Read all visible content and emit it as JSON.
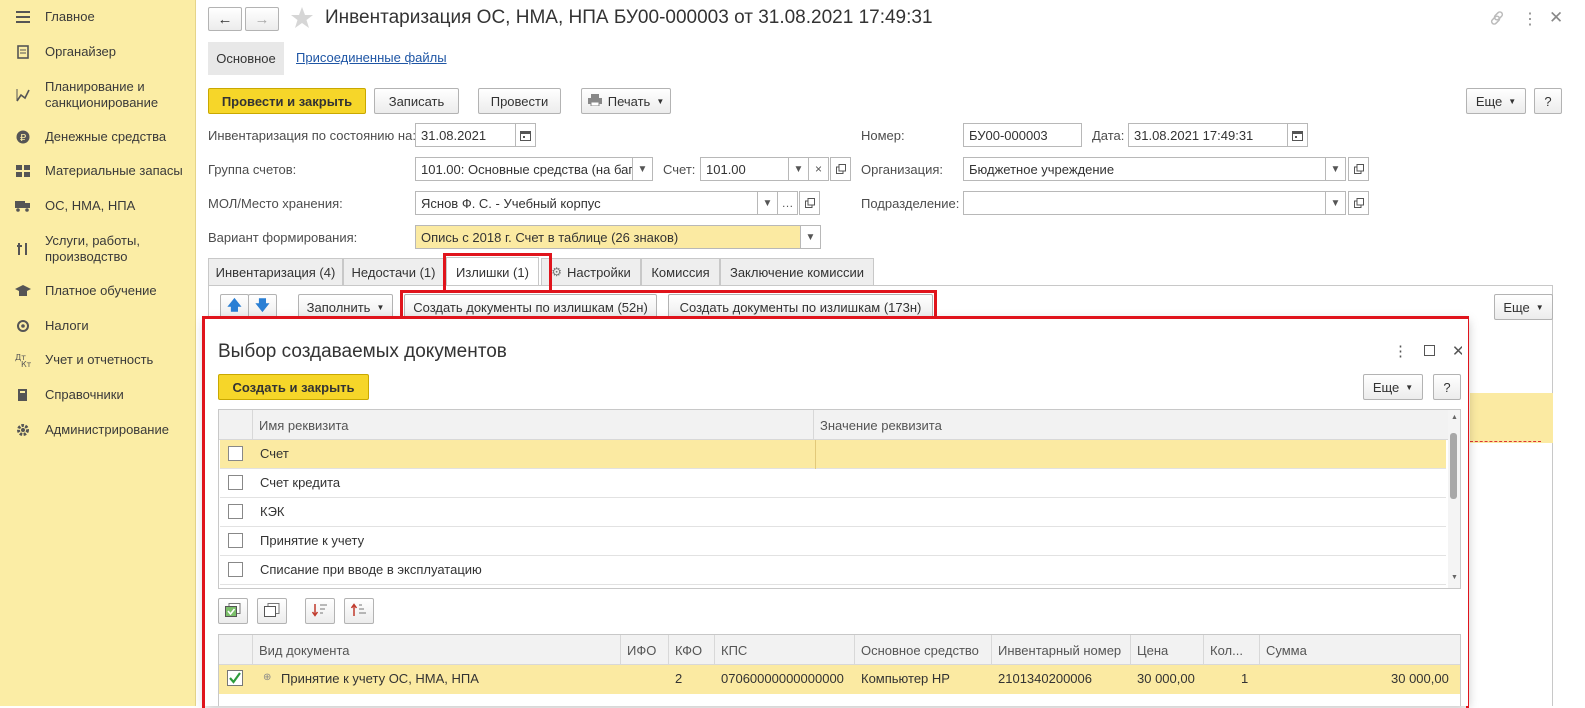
{
  "sidebar": {
    "items": [
      {
        "label": "Главное",
        "icon": "menu-icon"
      },
      {
        "label": "Органайзер",
        "icon": "organizer-icon"
      },
      {
        "label": "Планирование и санкционирование",
        "icon": "planning-icon"
      },
      {
        "label": "Денежные средства",
        "icon": "money-icon"
      },
      {
        "label": "Материальные запасы",
        "icon": "stock-icon"
      },
      {
        "label": "ОС, НМА, НПА",
        "icon": "truck-icon"
      },
      {
        "label": "Услуги, работы, производство",
        "icon": "tools-icon"
      },
      {
        "label": "Платное обучение",
        "icon": "education-icon"
      },
      {
        "label": "Налоги",
        "icon": "taxes-icon"
      },
      {
        "label": "Учет и отчетность",
        "icon": "accounting-icon"
      },
      {
        "label": "Справочники",
        "icon": "books-icon"
      },
      {
        "label": "Администрирование",
        "icon": "gear-icon"
      }
    ]
  },
  "header": {
    "title": "Инвентаризация ОС, НМА, НПА БУ00-000003 от 31.08.2021 17:49:31"
  },
  "subnav": {
    "main": "Основное",
    "files": "Присоединенные файлы"
  },
  "toolbar": {
    "post_close": "Провести и закрыть",
    "save": "Записать",
    "post": "Провести",
    "print": "Печать",
    "more": "Еще",
    "help": "?"
  },
  "form": {
    "inv_date_label": "Инвентаризация по состоянию на:",
    "inv_date": "31.08.2021",
    "number_label": "Номер:",
    "number": "БУ00-000003",
    "date_label": "Дата:",
    "date": "31.08.2021 17:49:31",
    "group_label": "Группа счетов:",
    "group": "101.00: Основные средства (на баг",
    "account_label": "Счет:",
    "account": "101.00",
    "org_label": "Организация:",
    "org": "Бюджетное учреждение",
    "mol_label": "МОЛ/Место хранения:",
    "mol": "Яснов Ф. С. - Учебный корпус",
    "dept_label": "Подразделение:",
    "dept": "",
    "variant_label": "Вариант формирования:",
    "variant": "Опись с 2018 г. Счет в таблице (26 знаков)"
  },
  "tabs": [
    {
      "label": "Инвентаризация (4)"
    },
    {
      "label": "Недостачи (1)"
    },
    {
      "label": "Излишки (1)"
    },
    {
      "label": "Настройки"
    },
    {
      "label": "Комиссия"
    },
    {
      "label": "Заключение комиссии"
    }
  ],
  "tabbar": {
    "fill": "Заполнить",
    "create52": "Создать документы по излишкам (52н)",
    "create173": "Создать документы по излишкам (173н)",
    "more": "Еще"
  },
  "dialog": {
    "title": "Выбор создаваемых документов",
    "create_close": "Создать и закрыть",
    "more": "Еще",
    "help": "?",
    "props_headers": [
      "Имя реквизита",
      "Значение реквизита"
    ],
    "props_rows": [
      "Счет",
      "Счет кредита",
      "КЭК",
      "Принятие к учету",
      "Списание при вводе в эксплуатацию"
    ],
    "docs_headers": [
      "Вид документа",
      "ИФО",
      "КФО",
      "КПС",
      "Основное средство",
      "Инвентарный номер",
      "Цена",
      "Кол...",
      "Сумма"
    ],
    "docs_row": {
      "doc": "Принятие к учету ОС, НМА, НПА",
      "ifo": "",
      "kfo": "2",
      "kps": "07060000000000000",
      "asset": "Компьютер HP",
      "inv": "2101340200006",
      "price": "30 000,00",
      "qty": "1",
      "sum": "30 000,00"
    }
  },
  "colors": {
    "sidebar": "#fbeda5",
    "accent_yellow": "#f6d629",
    "highlight_red": "#e0141c"
  }
}
